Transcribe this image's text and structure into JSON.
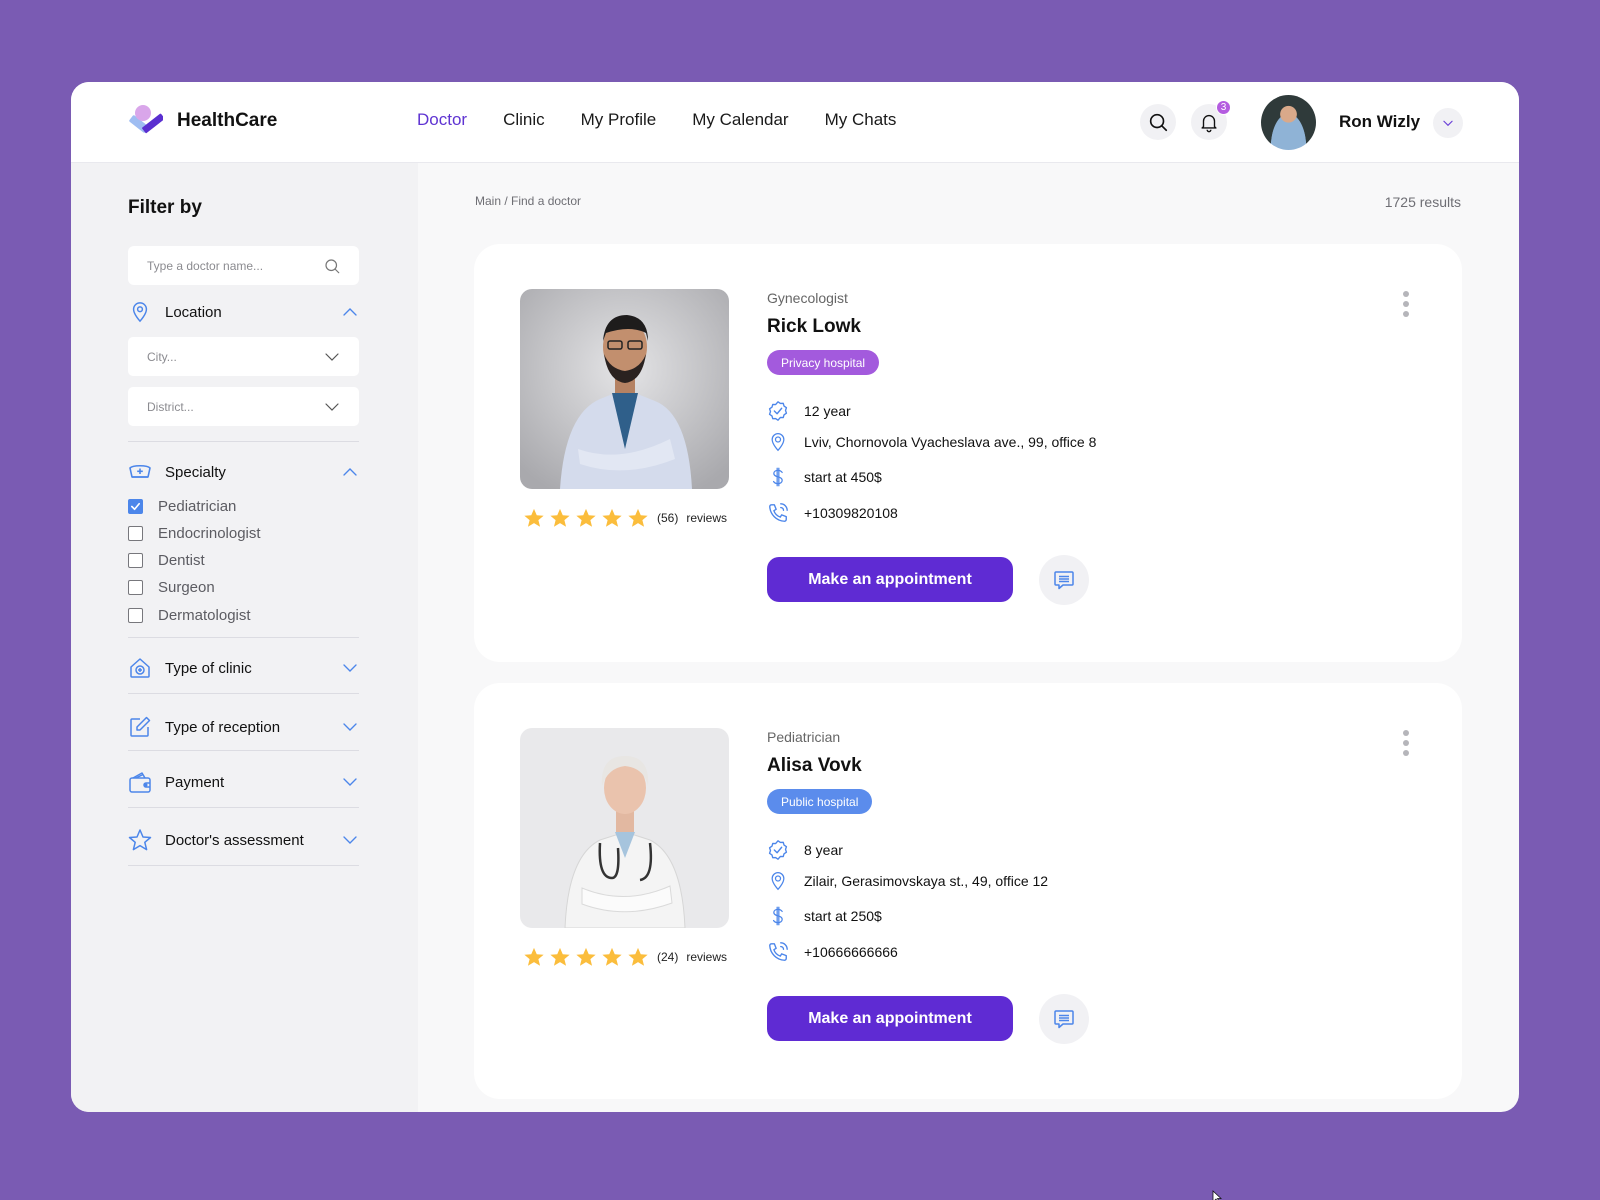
{
  "app": {
    "name": "HealthCare",
    "colors": {
      "accent": "#5f2bd3",
      "nav_active": "#5f34d2",
      "icon_blue": "#4c86ea",
      "star": "#fbbd3c",
      "background": "#7a5bb3"
    }
  },
  "header": {
    "nav": [
      {
        "label": "Doctor",
        "active": true
      },
      {
        "label": "Clinic",
        "active": false
      },
      {
        "label": "My Profile",
        "active": false
      },
      {
        "label": "My Calendar",
        "active": false
      },
      {
        "label": "My Chats",
        "active": false
      }
    ],
    "search_icon": "search-icon",
    "notifications": {
      "icon": "bell-icon",
      "count": "3"
    },
    "user": {
      "name": "Ron Wizly",
      "menu_icon": "chevron-down-icon"
    }
  },
  "sidebar": {
    "title": "Filter by",
    "search": {
      "placeholder": "Type a doctor name...",
      "value": ""
    },
    "location": {
      "label": "Location",
      "icon": "map-pin-icon",
      "expanded": true,
      "city_placeholder": "City...",
      "district_placeholder": "District..."
    },
    "specialty": {
      "label": "Specialty",
      "icon": "nurse-cap-icon",
      "expanded": true,
      "options": [
        {
          "label": "Pediatrician",
          "checked": true
        },
        {
          "label": "Endocrinologist",
          "checked": false
        },
        {
          "label": "Dentist",
          "checked": false
        },
        {
          "label": "Surgeon",
          "checked": false
        },
        {
          "label": "Dermatologist",
          "checked": false
        }
      ]
    },
    "sections": [
      {
        "label": "Type of clinic",
        "icon": "clinic-house-icon",
        "expanded": false
      },
      {
        "label": "Type of reception",
        "icon": "edit-icon",
        "expanded": false
      },
      {
        "label": "Payment",
        "icon": "wallet-icon",
        "expanded": false
      },
      {
        "label": "Doctor's assessment",
        "icon": "star-icon",
        "expanded": false
      }
    ]
  },
  "main": {
    "breadcrumb": "Main / Find a doctor",
    "results": "1725 results",
    "doctors": [
      {
        "specialty": "Gynecologist",
        "name": "Rick Lowk",
        "tag": "Privacy hospital",
        "tag_color": "#a35add",
        "rating": 5,
        "review_count": "(56)",
        "reviews_label": "reviews",
        "experience": "12 year",
        "address": "Lviv, Chornovola Vyacheslava ave., 99, office 8",
        "price": "start at 450$",
        "phone": "+10309820108",
        "appointment_label": "Make an appointment"
      },
      {
        "specialty": "Pediatrician",
        "name": "Alisa Vovk",
        "tag": "Public hospital",
        "tag_color": "#5b8cec",
        "rating": 5,
        "review_count": "(24)",
        "reviews_label": "reviews",
        "experience": "8 year",
        "address": "Zilair, Gerasimovskaya st., 49, office 12",
        "price": "start at 250$",
        "phone": "+10666666666",
        "appointment_label": "Make an appointment"
      }
    ]
  }
}
